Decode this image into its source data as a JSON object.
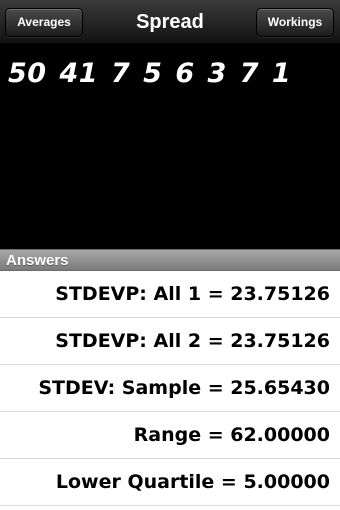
{
  "nav": {
    "left_button": "Averages",
    "title": "Spread",
    "right_button": "Workings"
  },
  "input": {
    "numbers_text": "50 41 7 5 6 3 7 1"
  },
  "answers_header": "Answers",
  "answers": [
    {
      "text": "STDEVP: All 1 = 23.75126"
    },
    {
      "text": "STDEVP: All 2 = 23.75126"
    },
    {
      "text": "STDEV: Sample = 25.65430"
    },
    {
      "text": "Range = 62.00000"
    },
    {
      "text": "Lower Quartile = 5.00000"
    }
  ]
}
